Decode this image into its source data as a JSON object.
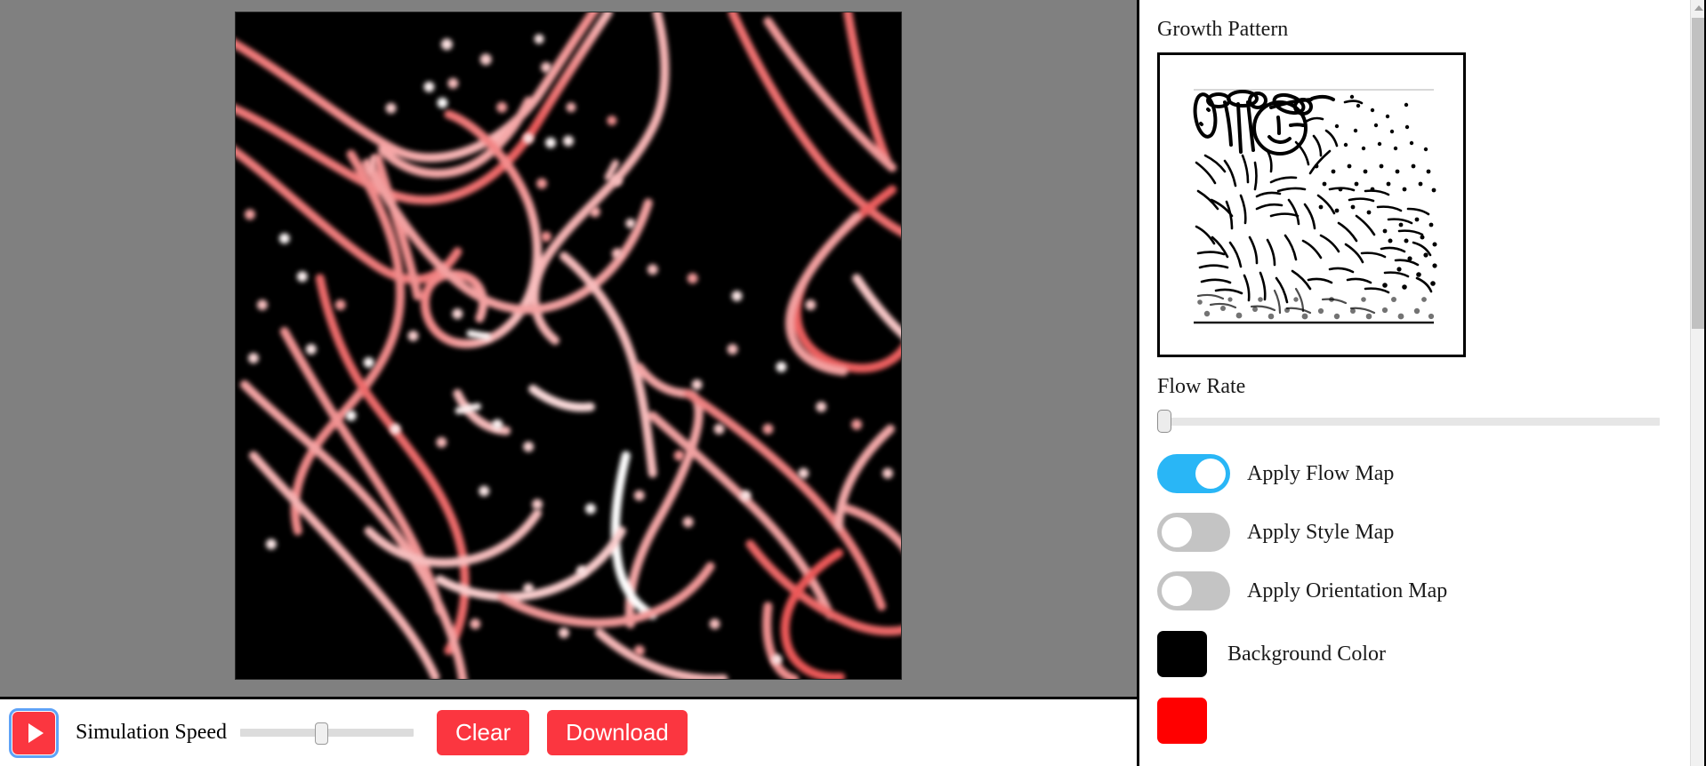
{
  "app": {
    "background_gray": "#808080",
    "accent_red": "#fb3640",
    "toggle_on_color": "#29b6f6",
    "toggle_off_color": "#c4c4c4"
  },
  "canvas": {
    "name": "differential-growth-simulation",
    "background_color": "#000000",
    "stroke_color": "#f08080"
  },
  "toolbar": {
    "play_icon": "play-triangle-icon",
    "simulation_speed_label": "Simulation Speed",
    "simulation_speed_value": 43,
    "clear_label": "Clear",
    "download_label": "Download"
  },
  "panel": {
    "growth_pattern": {
      "label": "Growth Pattern",
      "thumbnail_name": "growth-pattern-thumbnail"
    },
    "flow_rate": {
      "label": "Flow Rate",
      "value": 0
    },
    "toggles": [
      {
        "label": "Apply Flow Map",
        "state": "on"
      },
      {
        "label": "Apply Style Map",
        "state": "off"
      },
      {
        "label": "Apply Orientation Map",
        "state": "off"
      }
    ],
    "colors": [
      {
        "label": "Background Color",
        "value": "#000000"
      },
      {
        "label": "",
        "value": "#ff0000"
      }
    ]
  },
  "scrollbar": {
    "up_arrow_icon": "chevron-up-icon",
    "thumb_position": "top"
  }
}
